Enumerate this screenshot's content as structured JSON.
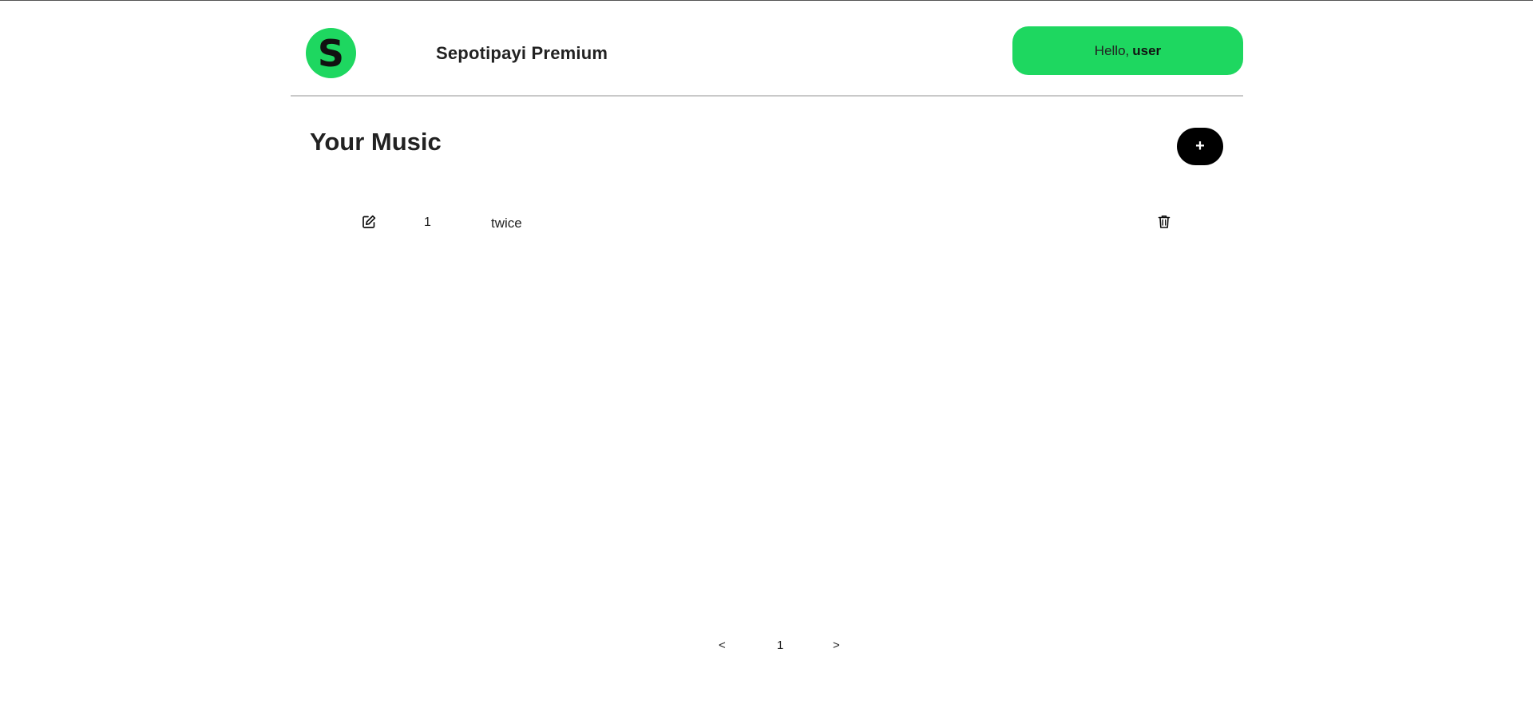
{
  "header": {
    "logo_letter": "S",
    "app_title": "Sepotipayi Premium",
    "greeting_prefix": "Hello,",
    "greeting_user": "user"
  },
  "main": {
    "section_title": "Your Music",
    "add_label": "+",
    "songs": [
      {
        "number": "1",
        "title": "twice"
      }
    ]
  },
  "pagination": {
    "prev_label": "<",
    "current_page": "1",
    "next_label": ">"
  },
  "colors": {
    "accent": "#1ed760",
    "add_button": "#000000"
  },
  "icons": {
    "edit": "edit-icon",
    "delete": "trash-icon"
  }
}
